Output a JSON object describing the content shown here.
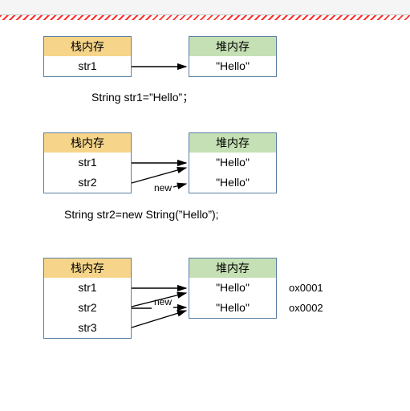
{
  "header_stack": "栈内存",
  "header_heap": "堆内存",
  "d1": {
    "stack": [
      "str1"
    ],
    "heap": [
      "\"Hello\""
    ],
    "caption": "String str1=”Hello”；"
  },
  "d2": {
    "stack": [
      "str1",
      "str2"
    ],
    "heap": [
      "\"Hello\"",
      "\"Hello\""
    ],
    "new_label": "new",
    "caption": "String str2=new String(”Hello”);"
  },
  "d3": {
    "stack": [
      "str1",
      "str2",
      "str3"
    ],
    "heap": [
      "\"Hello\"",
      "\"Hello\""
    ],
    "new_label": "new",
    "addr": [
      "ox0001",
      "ox0002"
    ]
  }
}
